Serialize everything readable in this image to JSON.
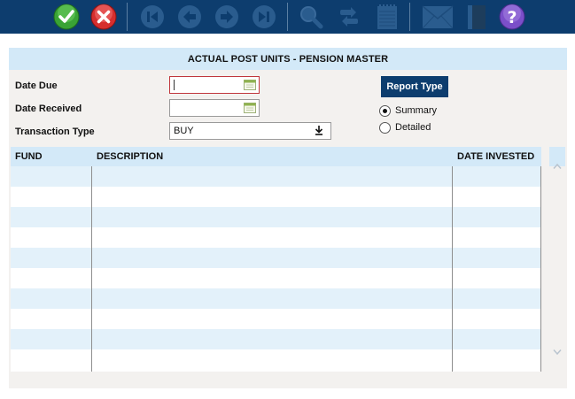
{
  "toolbar": {
    "buttons": [
      {
        "name": "accept",
        "icon": "check-circle-icon",
        "color": "#3aa335",
        "enabled": true
      },
      {
        "name": "cancel",
        "icon": "x-circle-icon",
        "color": "#d62e2e",
        "enabled": true
      },
      {
        "name": "first",
        "icon": "skip-first-icon",
        "enabled": false
      },
      {
        "name": "previous",
        "icon": "arrow-left-icon",
        "enabled": false
      },
      {
        "name": "next",
        "icon": "arrow-right-icon",
        "enabled": false
      },
      {
        "name": "last",
        "icon": "skip-last-icon",
        "enabled": false
      },
      {
        "name": "search",
        "icon": "magnifier-icon",
        "enabled": false
      },
      {
        "name": "refresh",
        "icon": "swap-arrows-icon",
        "enabled": false
      },
      {
        "name": "notes",
        "icon": "notepad-icon",
        "enabled": false
      },
      {
        "name": "mail",
        "icon": "envelope-icon",
        "enabled": false
      },
      {
        "name": "book",
        "icon": "book-icon",
        "enabled": false
      },
      {
        "name": "help",
        "icon": "question-circle-icon",
        "color": "#7b4fc9",
        "enabled": true
      }
    ],
    "background": "#0d3d6e"
  },
  "form": {
    "title": "ACTUAL POST UNITS - PENSION MASTER",
    "date_due_label": "Date Due",
    "date_due_value": "",
    "date_received_label": "Date Received",
    "date_received_value": "",
    "transaction_type_label": "Transaction Type",
    "transaction_type_value": "BUY",
    "report_type_button": "Report Type",
    "report_options": [
      {
        "label": "Summary",
        "checked": true
      },
      {
        "label": "Detailed",
        "checked": false
      }
    ]
  },
  "grid": {
    "columns": [
      "FUND",
      "DESCRIPTION",
      "DATE INVESTED"
    ],
    "rows": [],
    "header_color": "#d3e9f8",
    "alt_row_color": "#e3f1fa"
  }
}
